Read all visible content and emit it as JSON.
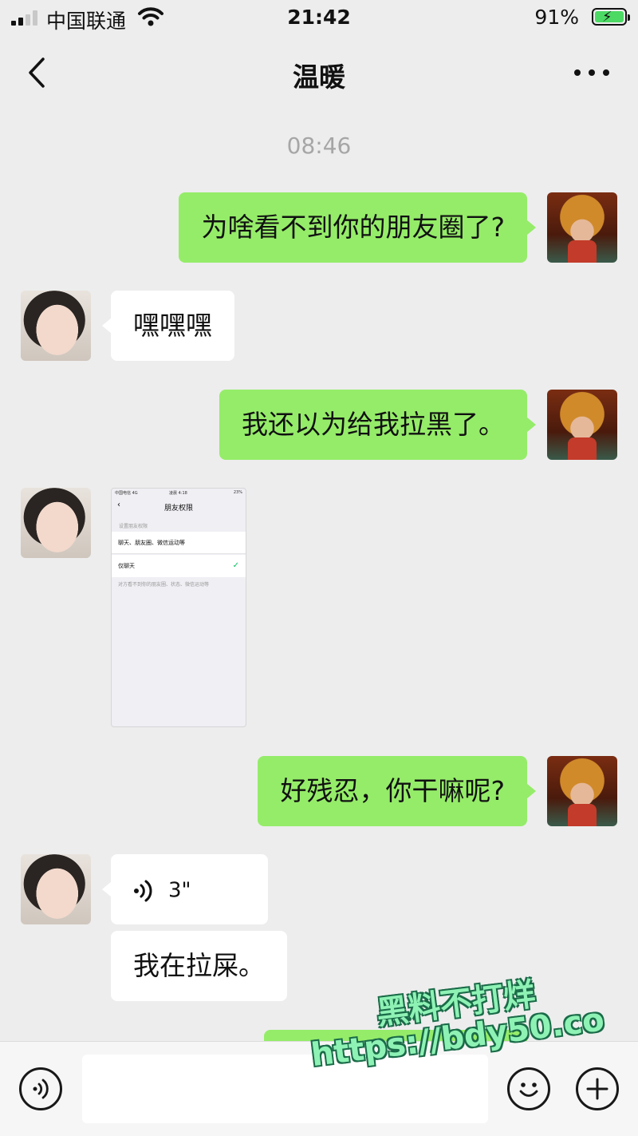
{
  "status_bar": {
    "carrier": "中国联通",
    "time": "21:42",
    "battery": "91%"
  },
  "nav": {
    "title": "温暖"
  },
  "timestamp": "08:46",
  "messages": {
    "m1": "为啥看不到你的朋友圈了?",
    "m2": "嘿嘿嘿",
    "m3": "我还以为给我拉黑了。",
    "m5": "好残忍，你干嘛呢?",
    "m6_voice_duration": "3\"",
    "m7": "我在拉屎。"
  },
  "screenshot_thumb": {
    "carrier": "中国电信 4G",
    "time": "凌晨 4:18",
    "battery": "23%",
    "title": "朋友权限",
    "section": "设置朋友权限",
    "option1": "聊天、朋友圈、微信运动等",
    "option2": "仅聊天",
    "note": "对方看不到你的朋友圈、状态、微信运动等"
  },
  "watermark": {
    "line1": "黑料不打烊",
    "line2": "https://bdy50.co"
  },
  "colors": {
    "self_bubble": "#95ec69",
    "other_bubble": "#ffffff",
    "background": "#ededed"
  }
}
